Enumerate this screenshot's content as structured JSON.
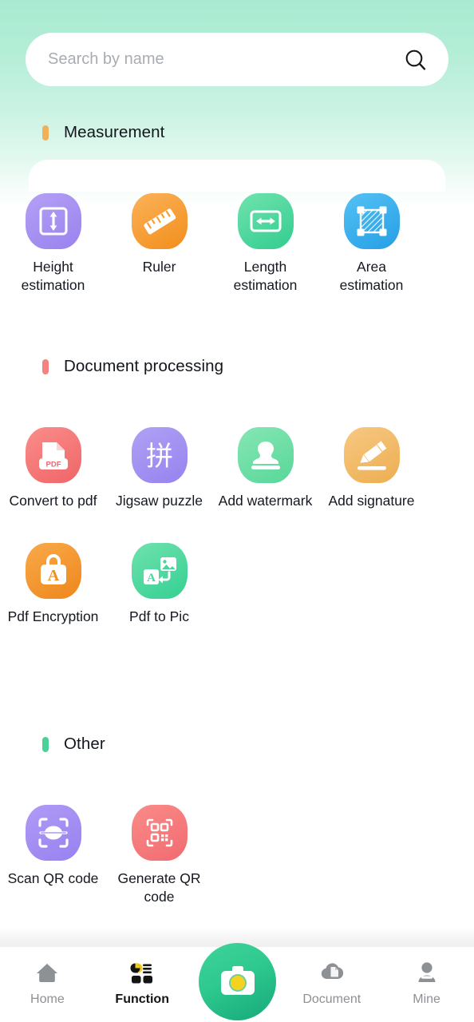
{
  "theme": {
    "bg_top": "#a8ead1",
    "bg_bottom": "#ffffff",
    "card_bg": "#ffffff",
    "camera_green": "#2ec98e",
    "camera_lens": "#f4d320",
    "active_tab_color": "#141414",
    "inactive_tab_color": "#8d9094"
  },
  "search": {
    "placeholder": "Search by name",
    "value": "",
    "icon": "search-icon"
  },
  "sections": [
    {
      "title": "Measurement",
      "bullet_color": "#efb25a",
      "items": [
        {
          "label": "Height estimation",
          "icon": "height-estimation-icon",
          "color_a": "#a58cf0",
          "color_b": "#9c87ee"
        },
        {
          "label": "Ruler",
          "icon": "ruler-icon",
          "color_a": "#f9a93f",
          "color_b": "#f59324"
        },
        {
          "label": "Length estimation",
          "icon": "length-estimation-icon",
          "color_a": "#66dfa8",
          "color_b": "#36cf93"
        },
        {
          "label": "Area estimation",
          "icon": "area-estimation-icon",
          "color_a": "#48b9f0",
          "color_b": "#2ba8ea"
        }
      ]
    },
    {
      "title": "Document processing",
      "bullet_color": "#f4837f",
      "items": [
        {
          "label": "Convert to pdf",
          "icon": "convert-to-pdf-icon",
          "color_a": "#f88382",
          "color_b": "#f36d6e"
        },
        {
          "label": "Jigsaw puzzle",
          "icon": "jigsaw-puzzle-icon",
          "color_a": "#a494f2",
          "color_b": "#9b88f0"
        },
        {
          "label": "Add watermark",
          "icon": "add-watermark-icon",
          "color_a": "#7ce3ae",
          "color_b": "#5dd99c"
        },
        {
          "label": "Add signature",
          "icon": "add-signature-icon",
          "color_a": "#f5c276",
          "color_b": "#efb25a"
        },
        {
          "label": "Pdf Encryption",
          "icon": "pdf-encryption-icon",
          "color_a": "#f79e3c",
          "color_b": "#ef8b22"
        },
        {
          "label": "Pdf to Pic",
          "icon": "pdf-to-pic-icon",
          "color_a": "#63dfa8",
          "color_b": "#3bd295"
        }
      ]
    },
    {
      "title": "Other",
      "bullet_color": "#4ad296",
      "items": [
        {
          "label": "Scan QR code",
          "icon": "scan-qr-code-icon",
          "color_a": "#a48cf2",
          "color_b": "#9a80f0"
        },
        {
          "label": "Generate QR code",
          "icon": "generate-qr-code-icon",
          "color_a": "#f8827f",
          "color_b": "#f36e72"
        }
      ]
    }
  ],
  "bottom_nav": {
    "items": [
      {
        "label": "Home",
        "icon": "home-icon",
        "active": false
      },
      {
        "label": "Function",
        "icon": "function-grid-icon",
        "active": true
      },
      {
        "label": "",
        "icon": "camera-icon",
        "active": false
      },
      {
        "label": "Document",
        "icon": "cloud-document-icon",
        "active": false
      },
      {
        "label": "Mine",
        "icon": "person-icon",
        "active": false
      }
    ],
    "camera_button_label": "camera-icon"
  }
}
